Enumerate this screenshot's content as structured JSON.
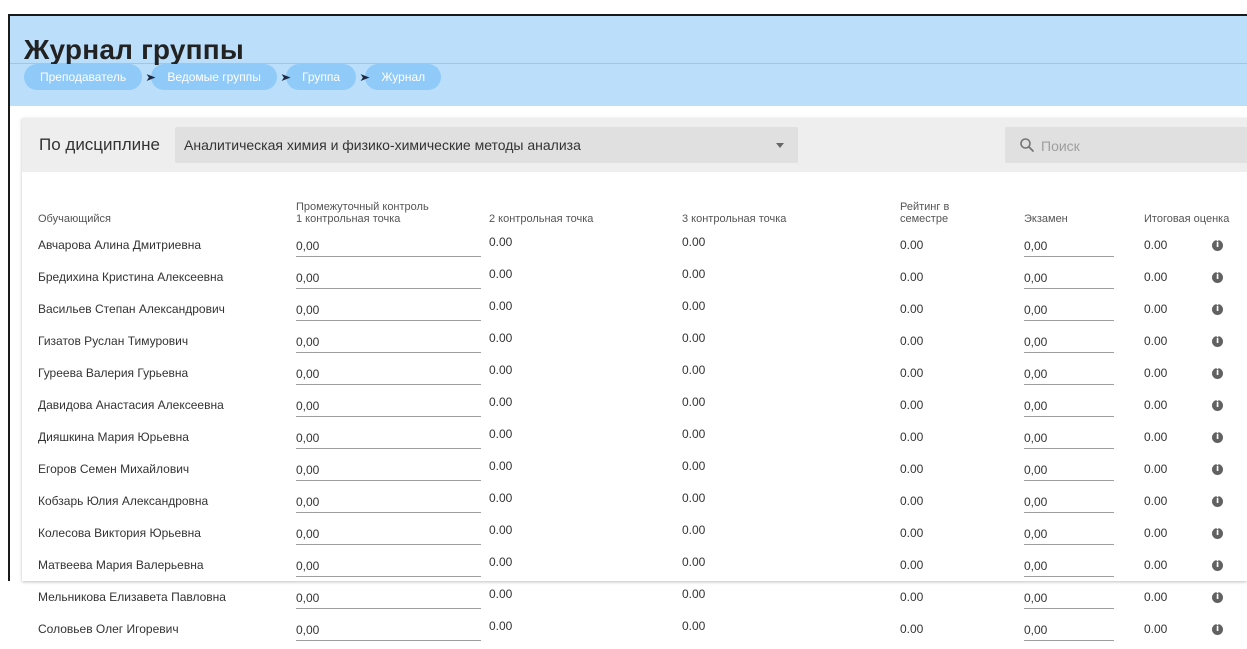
{
  "page": {
    "title": "Журнал группы"
  },
  "breadcrumb": [
    "Преподаватель",
    "Ведомые группы",
    "Группа",
    "Журнал"
  ],
  "filter": {
    "label": "По дисциплине",
    "discipline": "Аналитическая химия и физико-химические методы анализа",
    "search_placeholder": "Поиск"
  },
  "table": {
    "headers": {
      "student": "Обучающийся",
      "cp1_line1": "Промежуточный контроль",
      "cp1_line2": "1 контрольная точка",
      "cp2": "2 контрольная точка",
      "cp3": "3 контрольная точка",
      "rating_line1": "Рейтинг в",
      "rating_line2": "семестре",
      "exam": "Экзамен",
      "final": "Итоговая оценка"
    },
    "rows": [
      {
        "name": "Авчарова Алина Дмитриевна",
        "cp1": "0,00",
        "cp2": "0.00",
        "cp3": "0.00",
        "rating": "0.00",
        "exam": "0,00",
        "final": "0.00"
      },
      {
        "name": "Бредихина Кристина Алексеевна",
        "cp1": "0,00",
        "cp2": "0.00",
        "cp3": "0.00",
        "rating": "0.00",
        "exam": "0,00",
        "final": "0.00"
      },
      {
        "name": "Васильев Степан Александрович",
        "cp1": "0,00",
        "cp2": "0.00",
        "cp3": "0.00",
        "rating": "0.00",
        "exam": "0,00",
        "final": "0.00"
      },
      {
        "name": "Гизатов Руслан Тимурович",
        "cp1": "0,00",
        "cp2": "0.00",
        "cp3": "0.00",
        "rating": "0.00",
        "exam": "0,00",
        "final": "0.00"
      },
      {
        "name": "Гуреева Валерия Гурьевна",
        "cp1": "0,00",
        "cp2": "0.00",
        "cp3": "0.00",
        "rating": "0.00",
        "exam": "0,00",
        "final": "0.00"
      },
      {
        "name": "Давидова Анастасия Алексеевна",
        "cp1": "0,00",
        "cp2": "0.00",
        "cp3": "0.00",
        "rating": "0.00",
        "exam": "0,00",
        "final": "0.00"
      },
      {
        "name": "Дияшкина Мария Юрьевна",
        "cp1": "0,00",
        "cp2": "0.00",
        "cp3": "0.00",
        "rating": "0.00",
        "exam": "0,00",
        "final": "0.00"
      },
      {
        "name": "Егоров Семен Михайлович",
        "cp1": "0,00",
        "cp2": "0.00",
        "cp3": "0.00",
        "rating": "0.00",
        "exam": "0,00",
        "final": "0.00"
      },
      {
        "name": "Кобзарь Юлия Александровна",
        "cp1": "0,00",
        "cp2": "0.00",
        "cp3": "0.00",
        "rating": "0.00",
        "exam": "0,00",
        "final": "0.00"
      },
      {
        "name": "Колесова Виктория Юрьевна",
        "cp1": "0,00",
        "cp2": "0.00",
        "cp3": "0.00",
        "rating": "0.00",
        "exam": "0,00",
        "final": "0.00"
      },
      {
        "name": "Матвеева Мария Валерьевна",
        "cp1": "0,00",
        "cp2": "0.00",
        "cp3": "0.00",
        "rating": "0.00",
        "exam": "0,00",
        "final": "0.00"
      },
      {
        "name": "Мельникова Елизавета Павловна",
        "cp1": "0,00",
        "cp2": "0.00",
        "cp3": "0.00",
        "rating": "0.00",
        "exam": "0,00",
        "final": "0.00"
      },
      {
        "name": "Соловьев Олег Игоревич",
        "cp1": "0,00",
        "cp2": "0.00",
        "cp3": "0.00",
        "rating": "0.00",
        "exam": "0,00",
        "final": "0.00"
      }
    ]
  },
  "icons": {
    "search": "search-icon",
    "info": "info-icon",
    "breadcrumb_separator": "double-chevron-right-icon",
    "dropdown": "caret-down-icon"
  },
  "colors": {
    "header_bg": "#bbdefb",
    "crumb_bg": "#90caf9",
    "filter_bg": "#eeeeee",
    "select_bg": "#e0e0e0"
  }
}
